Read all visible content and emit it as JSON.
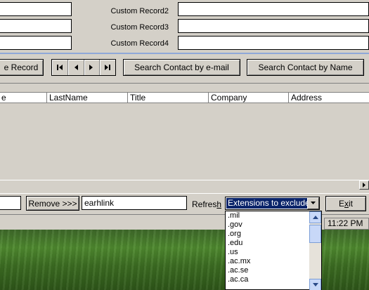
{
  "custom_fields": [
    {
      "label": "Custom Record2",
      "value": ""
    },
    {
      "label": "Custom Record3",
      "value": ""
    },
    {
      "label": "Custom Record4",
      "value": ""
    }
  ],
  "toolbar_top": {
    "record_button_label": "e Record",
    "nav_first": "|◀",
    "nav_prev": "◀",
    "nav_next": "▶",
    "nav_last": "▶|",
    "search_email_label": "Search Contact by e-mail",
    "search_name_label": "Search Contact by Name"
  },
  "grid": {
    "columns": [
      "e",
      "LastName",
      "Title",
      "Company",
      "Address"
    ]
  },
  "bottom_bar": {
    "left_input_value": "",
    "remove_label": "Remove >>>",
    "filter_value": "earhlink",
    "refresh_label_pre": "Refres",
    "refresh_label_u": "h",
    "exit_label_pre": "E",
    "exit_label_u": "x",
    "exit_label_post": "it"
  },
  "combo": {
    "selected": "Extensions to exclude",
    "options": [
      ".mil",
      ".gov",
      ".org",
      ".edu",
      ".us",
      ".ac.mx",
      ".ac.se",
      ".ac.ca"
    ]
  },
  "statusbar": {
    "time": "11:22 PM"
  },
  "colors": {
    "window_bg": "#d4d0c8",
    "selection": "#0a246a",
    "accent_line": "#8fa8d8"
  }
}
